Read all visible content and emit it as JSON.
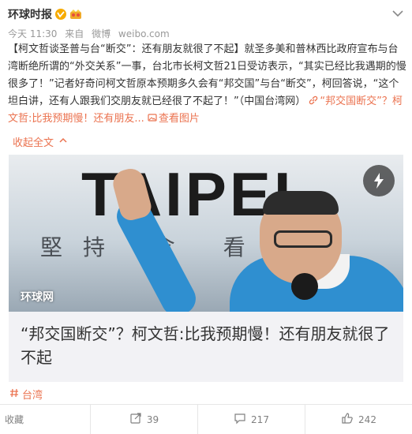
{
  "post": {
    "author": "环球时报",
    "meta_time": "今天 11:30",
    "meta_source_prefix": "来自",
    "meta_source_1": "微博",
    "meta_source_2": "weibo.com",
    "text": {
      "part1": "【柯文哲谈圣普与台“断交”：还有朋友就很了不起】就圣多美和普林西比政府宣布与台湾断绝所谓的“外交关系”一事，台北市长柯文哲21日受访表示，“其实已经比我遇期的慢很多了！”记者好奇问柯文哲原本预期多久会有“邦交国”与台“断交”，柯回答说，“这个坦白讲，还有人跟我们交朋友就已经很了不起了！”（中国台湾网）",
      "link1": "“邦交国断交”？柯文哲:比我预期慢！还有朋友...",
      "link2": "查看图片"
    },
    "collapse_label": "收起全文",
    "card": {
      "image_main_text": "TAIPEI",
      "image_slogan": "堅持 念 看",
      "watermark": "环球网",
      "title": "“邦交国断交”？柯文哲:比我预期慢！还有朋友就很了不起"
    },
    "topic": "台湾"
  },
  "actions": {
    "favorite_label": "收藏",
    "repost_count": "39",
    "comment_count": "217",
    "like_count": "242"
  },
  "colors": {
    "accent": "#eb7350",
    "text": "#333333",
    "muted": "#999999",
    "card_bg": "#f2f2f5"
  },
  "icons": {
    "verified": "verified-badge-icon",
    "vip": "crown-icon",
    "more": "chevron-down-icon",
    "link": "link-icon",
    "image": "image-icon",
    "collapse": "chevron-up-icon",
    "flash": "flash-icon",
    "topic": "hashtag-icon",
    "repost": "repost-icon",
    "comment": "comment-icon",
    "like": "thumbs-up-icon"
  }
}
